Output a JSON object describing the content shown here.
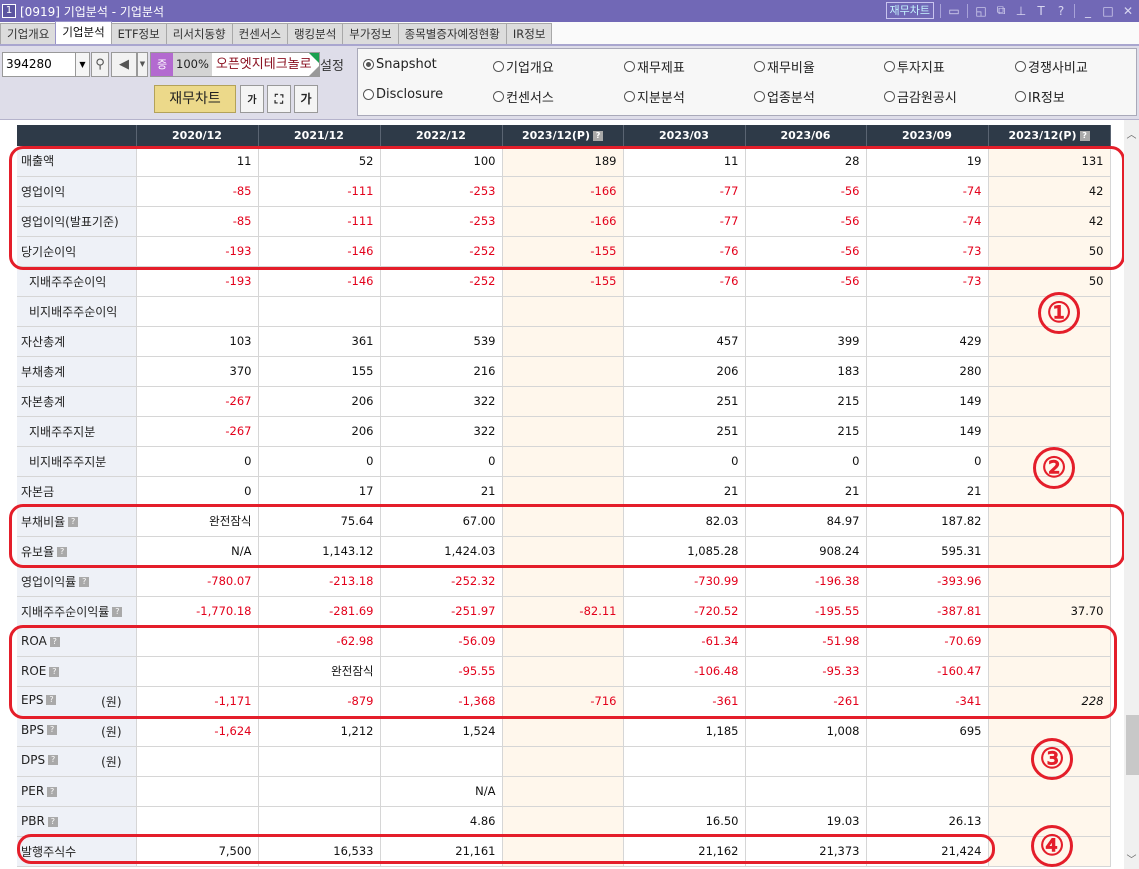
{
  "window": {
    "number": "1",
    "title": "[0919] 기업분석 - 기업분석",
    "finance_chart_btn": "재무차트",
    "icons": [
      "chart-icon",
      "restore-icon",
      "window-icon",
      "pin-icon",
      "text-icon",
      "help-icon",
      "minimize-icon",
      "maximize-icon",
      "close-icon"
    ]
  },
  "tabs": [
    {
      "label": "기업개요",
      "active": false
    },
    {
      "label": "기업분석",
      "active": true
    },
    {
      "label": "ETF정보",
      "active": false
    },
    {
      "label": "리서치동향",
      "active": false
    },
    {
      "label": "컨센서스",
      "active": false
    },
    {
      "label": "랭킹분석",
      "active": false
    },
    {
      "label": "부가정보",
      "active": false
    },
    {
      "label": "종목별증자예정현황",
      "active": false
    },
    {
      "label": "IR정보",
      "active": false
    }
  ],
  "toolbar": {
    "stock_code": "394280",
    "badge": "증",
    "zoom": "100%",
    "stock_name": "오픈엣지테크놀로",
    "settings": "설정",
    "finance_chart": "재무차트",
    "font_down": "가",
    "fit": "⛶",
    "font_up": "가"
  },
  "radios": [
    {
      "label": "Snapshot",
      "checked": true
    },
    {
      "label": "기업개요",
      "checked": false
    },
    {
      "label": "재무제표",
      "checked": false
    },
    {
      "label": "재무비율",
      "checked": false
    },
    {
      "label": "투자지표",
      "checked": false
    },
    {
      "label": "경쟁사비교",
      "checked": false
    },
    {
      "label": "Disclosure",
      "checked": false
    },
    {
      "label": "컨센서스",
      "checked": false
    },
    {
      "label": "지분분석",
      "checked": false
    },
    {
      "label": "업종분석",
      "checked": false
    },
    {
      "label": "금감원공시",
      "checked": false
    },
    {
      "label": "IR정보",
      "checked": false
    }
  ],
  "table": {
    "columns": [
      "2020/12",
      "2021/12",
      "2022/12",
      "2023/12(P)",
      "2023/03",
      "2023/06",
      "2023/09",
      "2023/12(P)"
    ],
    "rows": [
      {
        "label": "매출액",
        "values": [
          "11",
          "52",
          "100",
          "189",
          "11",
          "28",
          "19",
          "131"
        ]
      },
      {
        "label": "영업이익",
        "values": [
          "-85",
          "-111",
          "-253",
          "-166",
          "-77",
          "-56",
          "-74",
          "42"
        ]
      },
      {
        "label": "영업이익(발표기준)",
        "values": [
          "-85",
          "-111",
          "-253",
          "-166",
          "-77",
          "-56",
          "-74",
          "42"
        ]
      },
      {
        "label": "당기순이익",
        "values": [
          "-193",
          "-146",
          "-252",
          "-155",
          "-76",
          "-56",
          "-73",
          "50"
        ]
      },
      {
        "label": "지배주주순이익",
        "values": [
          "-193",
          "-146",
          "-252",
          "-155",
          "-76",
          "-56",
          "-73",
          "50"
        ]
      },
      {
        "label": "비지배주주순이익",
        "values": [
          "",
          "",
          "",
          "",
          "",
          "",
          "",
          ""
        ]
      },
      {
        "label": "자산총계",
        "values": [
          "103",
          "361",
          "539",
          "",
          "457",
          "399",
          "429",
          ""
        ]
      },
      {
        "label": "부채총계",
        "values": [
          "370",
          "155",
          "216",
          "",
          "206",
          "183",
          "280",
          ""
        ]
      },
      {
        "label": "자본총계",
        "values": [
          "-267",
          "206",
          "322",
          "",
          "251",
          "215",
          "149",
          ""
        ]
      },
      {
        "label": "지배주주지분",
        "values": [
          "-267",
          "206",
          "322",
          "",
          "251",
          "215",
          "149",
          ""
        ]
      },
      {
        "label": "비지배주주지분",
        "values": [
          "0",
          "0",
          "0",
          "",
          "0",
          "0",
          "0",
          ""
        ]
      },
      {
        "label": "자본금",
        "values": [
          "0",
          "17",
          "21",
          "",
          "21",
          "21",
          "21",
          ""
        ]
      },
      {
        "label": "부채비율",
        "values": [
          "완전잠식",
          "75.64",
          "67.00",
          "",
          "82.03",
          "84.97",
          "187.82",
          ""
        ]
      },
      {
        "label": "유보율",
        "values": [
          "N/A",
          "1,143.12",
          "1,424.03",
          "",
          "1,085.28",
          "908.24",
          "595.31",
          ""
        ]
      },
      {
        "label": "영업이익률",
        "values": [
          "-780.07",
          "-213.18",
          "-252.32",
          "",
          "-730.99",
          "-196.38",
          "-393.96",
          ""
        ]
      },
      {
        "label": "지배주주순이익률",
        "values": [
          "-1,770.18",
          "-281.69",
          "-251.97",
          "-82.11",
          "-720.52",
          "-195.55",
          "-387.81",
          "37.70"
        ]
      },
      {
        "label": "ROA",
        "values": [
          "",
          "-62.98",
          "-56.09",
          "",
          "-61.34",
          "-51.98",
          "-70.69",
          ""
        ]
      },
      {
        "label": "ROE",
        "values": [
          "",
          "완전잠식",
          "-95.55",
          "",
          "-106.48",
          "-95.33",
          "-160.47",
          ""
        ]
      },
      {
        "label": "EPS",
        "unit": "(원)",
        "values": [
          "-1,171",
          "-879",
          "-1,368",
          "-716",
          "-361",
          "-261",
          "-341",
          "228"
        ]
      },
      {
        "label": "BPS",
        "unit": "(원)",
        "values": [
          "-1,624",
          "1,212",
          "1,524",
          "",
          "1,185",
          "1,008",
          "695",
          ""
        ]
      },
      {
        "label": "DPS",
        "unit": "(원)",
        "values": [
          "",
          "",
          "",
          "",
          "",
          "",
          "",
          ""
        ]
      },
      {
        "label": "PER",
        "values": [
          "",
          "",
          "N/A",
          "",
          "",
          "",
          "",
          ""
        ]
      },
      {
        "label": "PBR",
        "values": [
          "",
          "",
          "4.86",
          "",
          "16.50",
          "19.03",
          "26.13",
          ""
        ]
      },
      {
        "label": "발행주식수",
        "values": [
          "7,500",
          "16,533",
          "21,161",
          "",
          "21,162",
          "21,373",
          "21,424",
          ""
        ]
      }
    ]
  },
  "annotations": [
    "①",
    "②",
    "③",
    "④"
  ],
  "colors": {
    "titlebar": "#7168b6",
    "header": "#2e3a48",
    "negative": "#e3001b",
    "estimate_bg": "#fff7ec",
    "highlight": "#e41e2a"
  }
}
